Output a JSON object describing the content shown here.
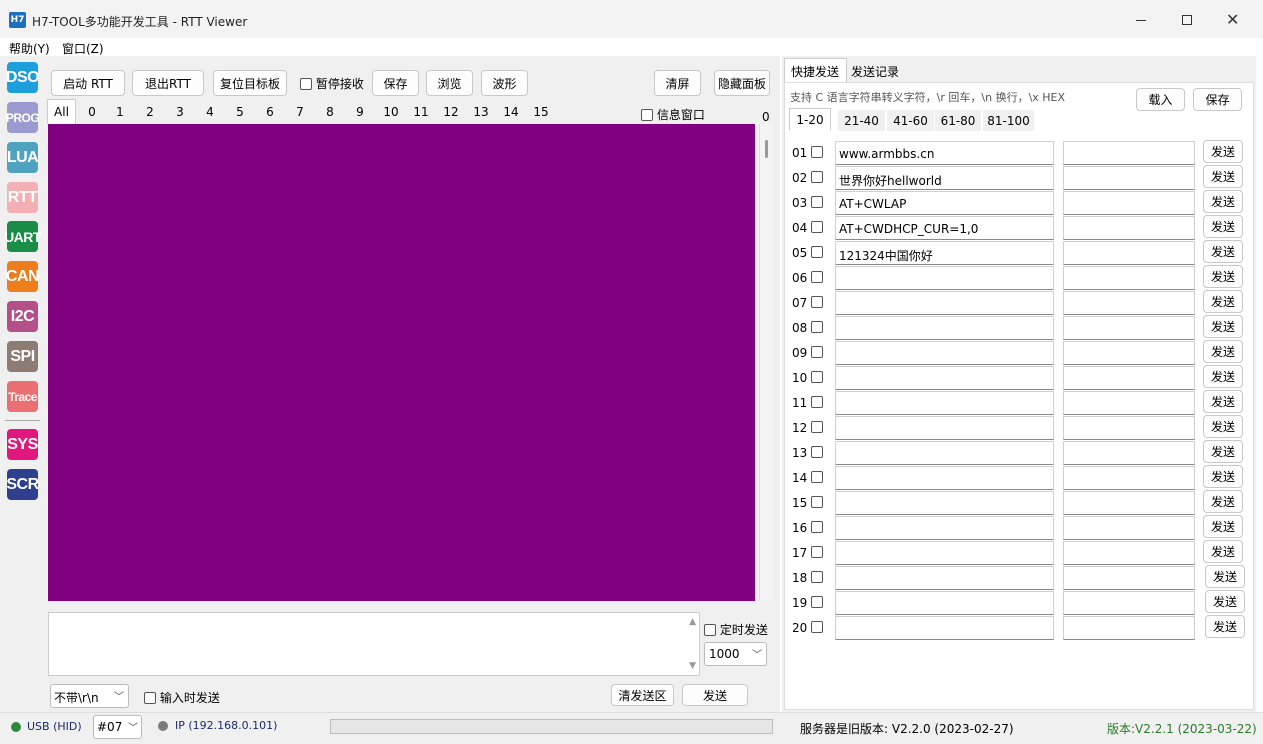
{
  "window": {
    "app_icon": "H7",
    "title": "H7-TOOL多功能开发工具 - RTT Viewer"
  },
  "menu": [
    "帮助(Y)",
    "窗口(Z)"
  ],
  "sidebar": [
    {
      "label": "DSO",
      "color": "#1d9fdc"
    },
    {
      "label": "PROG",
      "color": "#9c9bd0"
    },
    {
      "label": "LUA",
      "color": "#4fa3bf"
    },
    {
      "label": "RTT",
      "color": "#f2b0b4"
    },
    {
      "label": "UART",
      "color": "#1a8c48"
    },
    {
      "label": "CAN",
      "color": "#ee7d1c"
    },
    {
      "label": "I2C",
      "color": "#b3508a"
    },
    {
      "label": "SPI",
      "color": "#8c7c73"
    },
    {
      "label": "Trace",
      "color": "#e96f73"
    },
    {
      "label": "SYS",
      "color": "#e2177d"
    },
    {
      "label": "SCR",
      "color": "#2e3f8f"
    }
  ],
  "toolbar": {
    "start": "启动 RTT",
    "exit": "退出RTT",
    "reset": "复位目标板",
    "pause": "暂停接收",
    "save": "保存",
    "browse": "浏览",
    "wave": "波形",
    "clear": "清屏",
    "hide": "隐藏面板"
  },
  "channel_tabs": [
    "All",
    "0",
    "1",
    "2",
    "3",
    "4",
    "5",
    "6",
    "7",
    "8",
    "9",
    "10",
    "11",
    "12",
    "13",
    "14",
    "15"
  ],
  "info_window": "信息窗口",
  "counter": "0",
  "terminal_color": "#800080",
  "send_area": {
    "timer_label": "定时发送",
    "timer_value": "1000",
    "eol": "不带\\r\\n",
    "send_on_input": "输入时发送",
    "clear_btn": "清发送区",
    "send_btn": "发送"
  },
  "right_panel": {
    "tabs": [
      "快捷发送",
      "发送记录"
    ],
    "hint": "支持 C 语言字符串转义字符，\\r 回车，\\n 换行，\\x HEX",
    "load": "载入",
    "save": "保存",
    "range_tabs": [
      "1-20",
      "21-40",
      "41-60",
      "61-80",
      "81-100"
    ],
    "send_label": "发送",
    "rows": [
      {
        "num": "01",
        "text": "www.armbbs.cn"
      },
      {
        "num": "02",
        "text": "世界你好hellworld"
      },
      {
        "num": "03",
        "text": "AT+CWLAP"
      },
      {
        "num": "04",
        "text": "AT+CWDHCP_CUR=1,0"
      },
      {
        "num": "05",
        "text": "121324中国你好"
      },
      {
        "num": "06",
        "text": ""
      },
      {
        "num": "07",
        "text": ""
      },
      {
        "num": "08",
        "text": ""
      },
      {
        "num": "09",
        "text": ""
      },
      {
        "num": "10",
        "text": ""
      },
      {
        "num": "11",
        "text": ""
      },
      {
        "num": "12",
        "text": ""
      },
      {
        "num": "13",
        "text": ""
      },
      {
        "num": "14",
        "text": ""
      },
      {
        "num": "15",
        "text": ""
      },
      {
        "num": "16",
        "text": ""
      },
      {
        "num": "17",
        "text": ""
      },
      {
        "num": "18",
        "text": ""
      },
      {
        "num": "19",
        "text": ""
      },
      {
        "num": "20",
        "text": ""
      }
    ]
  },
  "status": {
    "usb": "USB (HID)",
    "device": "#07",
    "ip": "IP (192.168.0.101)",
    "server": "服务器是旧版本: V2.2.0 (2023-02-27)",
    "version": "版本:V2.2.1 (2023-03-22)",
    "usb_color": "#2a8a3a",
    "ip_color": "#7a7a7a",
    "version_color": "#2a7a2a"
  }
}
